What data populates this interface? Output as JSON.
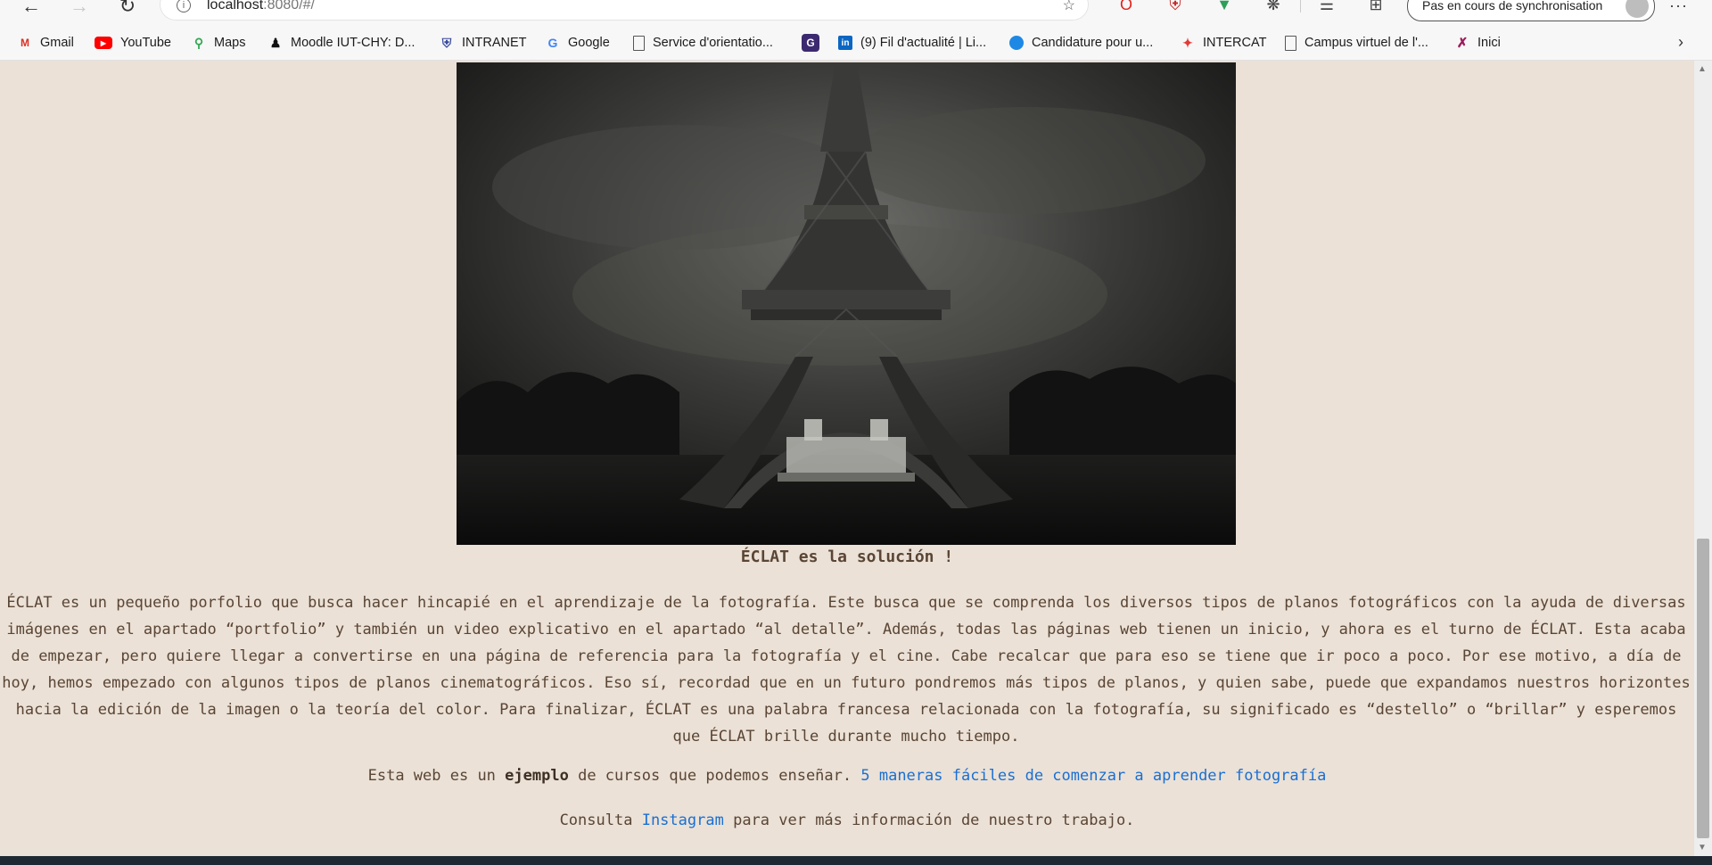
{
  "browser": {
    "address": {
      "host": "localhost",
      "path": ":8080/#/"
    },
    "sync_button_label": "Pas en cours de synchronisation",
    "bookmarks": [
      {
        "label": "Gmail",
        "icon": "gmail-icon",
        "color": "#d93025"
      },
      {
        "label": "YouTube",
        "icon": "youtube-icon",
        "color": "#ff0000"
      },
      {
        "label": "Maps",
        "icon": "maps-icon",
        "color": "#34a853"
      },
      {
        "label": "Moodle IUT-CHY: D...",
        "icon": "moodle-icon",
        "color": "#111111"
      },
      {
        "label": "INTRANET",
        "icon": "intranet-icon",
        "color": "#3b4a9c"
      },
      {
        "label": "Google",
        "icon": "google-icon",
        "color": "#4285f4"
      },
      {
        "label": "Service d'orientatio...",
        "icon": "page-icon",
        "color": "#555555"
      },
      {
        "label": "",
        "icon": "g-app-icon",
        "color": "#3c2a70"
      },
      {
        "label": "(9) Fil d'actualité | Li...",
        "icon": "linkedin-icon",
        "color": "#0a66c2"
      },
      {
        "label": "Candidature pour u...",
        "icon": "globe-icon",
        "color": "#1e88e5"
      },
      {
        "label": "INTERCAT",
        "icon": "intercat-icon",
        "color": "#e53935"
      },
      {
        "label": "Campus virtuel de l'...",
        "icon": "page-icon",
        "color": "#555555"
      },
      {
        "label": "Inici",
        "icon": "inici-icon",
        "color": "#9c1c5b"
      }
    ]
  },
  "page": {
    "hero_alt": "Torre Eiffel",
    "caption": "ÉCLAT es la solución !",
    "paragraph": "ÉCLAT es un pequeño porfolio que busca hacer hincapié en el aprendizaje de la fotografía. Este busca que se comprenda los diversos tipos de planos fotográficos con la ayuda de diversas imágenes en el apartado “portfolio” y también un video explicativo en el apartado “al detalle”. Además, todas las páginas web tienen un inicio, y ahora es el turno de ÉCLAT. Esta acaba de empezar, pero quiere llegar a convertirse en una página de referencia para la fotografía y el cine. Cabe recalcar que para eso se tiene que ir poco a poco. Por ese motivo, a día de hoy, hemos empezado con algunos tipos de planos cinematográficos. Eso sí, recordad que en un futuro pondremos más tipos de planos, y quien sabe, puede que expandamos nuestros horizontes hacia la edición de la imagen o la teoría del color. Para finalizar, ÉCLAT es una palabra francesa relacionada con la fotografía, su significado es “destello” o “brillar” y esperemos que ÉCLAT brille durante mucho tiempo.",
    "course_prefix": "Esta web es un",
    "course_emphasis": "ejemplo",
    "course_middle": "de cursos que podemos enseñar.",
    "course_link": "5 maneras fáciles de comenzar a aprender fotografía",
    "contact_prefix": "Consulta",
    "contact_link": "Instagram",
    "contact_suffix": "para ver más información de nuestro trabajo."
  },
  "colors": {
    "page_background": "#ebe1d6",
    "text": "#5a4535",
    "link": "#1a6fd3"
  }
}
